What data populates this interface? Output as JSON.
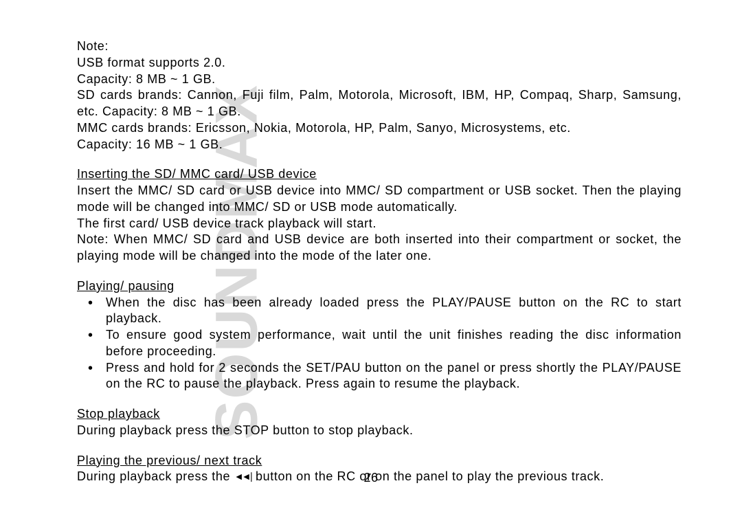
{
  "brand": "SOUNDMAX",
  "note_label": "Note:",
  "note_lines": {
    "l1": "USB format supports 2.0.",
    "l2": "Capacity: 8 MB ~ 1 GB.",
    "l3": "SD cards brands: Cannon, Fuji film, Palm, Motorola, Microsoft, IBM, HP, Compaq, Sharp, Samsung, etc. Capacity: 8 MB ~ 1 GB.",
    "l4": "MMC cards brands: Ericsson, Nokia, Motorola, HP, Palm, Sanyo, Microsystems, etc.",
    "l5": "Capacity: 16 MB ~ 1 GB."
  },
  "insert": {
    "heading": "Inserting the SD/ MMC card/ USB device",
    "p1": "Insert the MMC/ SD card or USB device into MMC/ SD compartment or USB socket. Then the playing mode will be changed into MMC/ SD or USB mode automatically.",
    "p2": "The first card/ USB device track playback will start.",
    "p3": "Note: When MMC/ SD card and USB device are both inserted into their compartment or socket, the playing mode will be changed into the mode of the later one."
  },
  "playing": {
    "heading": "Playing/ pausing",
    "b1": "When the disc has been already loaded press the PLAY/PAUSE button on the RC to start playback.",
    "b2": "To ensure good system performance, wait until the unit finishes reading the disc information before proceeding.",
    "b3": "Press and hold for 2 seconds the SET/PAU button on the panel or press shortly the PLAY/PAUSE on the RC to pause the playback. Press again to resume the playback."
  },
  "stop": {
    "heading": "Stop playback",
    "p1": "During playback press the STOP button to stop playback."
  },
  "prevnext": {
    "heading": "Playing the previous/ next track",
    "p1a": "During playback press the ",
    "icon": "◄◄∣",
    "p1b": " button on the RC or on the panel to play the previous track."
  },
  "page_number": "26"
}
